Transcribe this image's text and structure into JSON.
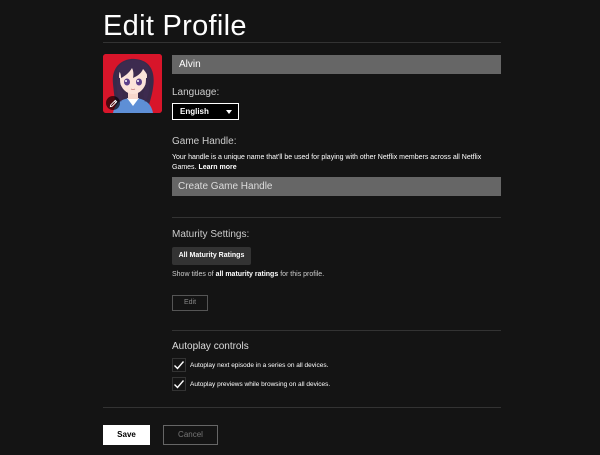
{
  "page": {
    "title": "Edit Profile"
  },
  "profile": {
    "name_value": "Alvin",
    "avatar_icon": "anime-avatar-icon",
    "edit_avatar_icon": "pencil-icon"
  },
  "language": {
    "label": "Language:",
    "selected": "English"
  },
  "game_handle": {
    "label": "Game Handle:",
    "help_text": "Your handle is a unique name that'll be used for playing with other Netflix members across all Netflix Games.",
    "learn_more": "Learn more",
    "placeholder": "Create Game Handle"
  },
  "maturity": {
    "label": "Maturity Settings:",
    "badge": "All Maturity Ratings",
    "desc_prefix": "Show titles of",
    "desc_bold": "all maturity ratings",
    "desc_suffix": "for this profile.",
    "edit_label": "Edit"
  },
  "autoplay": {
    "label": "Autoplay controls",
    "options": [
      {
        "label": "Autoplay next episode in a series on all devices.",
        "checked": true
      },
      {
        "label": "Autoplay previews while browsing on all devices.",
        "checked": true
      }
    ]
  },
  "actions": {
    "save_label": "Save",
    "cancel_label": "Cancel"
  },
  "colors": {
    "background": "#141414",
    "avatar_bg": "#d8152a"
  }
}
